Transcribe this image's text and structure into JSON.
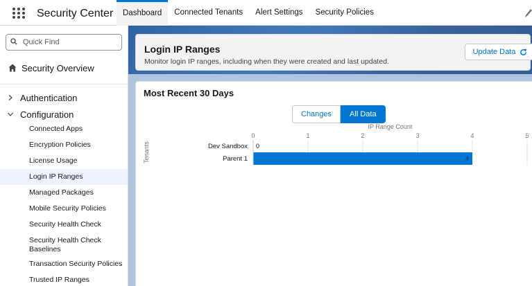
{
  "app": {
    "name": "Security Center"
  },
  "tabs": [
    {
      "label": "Dashboard",
      "active": true
    },
    {
      "label": "Connected Tenants",
      "active": false
    },
    {
      "label": "Alert Settings",
      "active": false
    },
    {
      "label": "Security Policies",
      "active": false
    }
  ],
  "sidebar": {
    "quick_find_placeholder": "Quick Find",
    "overview": "Security Overview",
    "sections": [
      {
        "label": "Authentication",
        "expanded": false
      },
      {
        "label": "Configuration",
        "expanded": true
      }
    ],
    "items": [
      {
        "label": "Connected Apps"
      },
      {
        "label": "Encryption Policies"
      },
      {
        "label": "License Usage"
      },
      {
        "label": "Login IP Ranges",
        "active": true
      },
      {
        "label": "Managed Packages"
      },
      {
        "label": "Mobile Security Policies"
      },
      {
        "label": "Security Health Check"
      },
      {
        "label": "Security Health Check Baselines"
      },
      {
        "label": "Transaction Security Policies"
      },
      {
        "label": "Trusted IP Ranges"
      }
    ]
  },
  "header": {
    "title": "Login IP Ranges",
    "subtitle": "Monitor login IP ranges, including when they were created and last updated.",
    "update_button": "Update Data"
  },
  "card": {
    "title": "Most Recent 30 Days",
    "toggle": [
      {
        "label": "Changes",
        "selected": false
      },
      {
        "label": "All Data",
        "selected": true
      }
    ]
  },
  "colors": {
    "brand": "#0176d3",
    "bar": "#0176d3"
  },
  "chart_data": {
    "type": "bar",
    "orientation": "horizontal",
    "xlabel": "IP Range Count",
    "ylabel": "Tenants",
    "categories": [
      "Dev Sandbox",
      "Parent 1"
    ],
    "values": [
      0,
      4
    ],
    "data_labels": [
      "0",
      "4"
    ],
    "xlim": [
      0,
      5
    ],
    "xticks": [
      "0",
      "1",
      "2",
      "3",
      "4",
      "5"
    ],
    "grid": true
  }
}
